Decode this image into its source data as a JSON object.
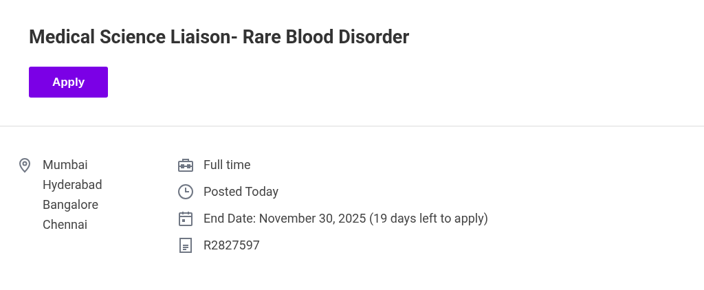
{
  "job": {
    "title": "Medical Science Liaison- Rare Blood Disorder",
    "apply_button": "Apply"
  },
  "locations": [
    "Mumbai",
    "Hyderabad",
    "Bangalore",
    "Chennai"
  ],
  "details": [
    {
      "kind": "job-type",
      "text": "Full time"
    },
    {
      "kind": "posted",
      "text": "Posted Today"
    },
    {
      "kind": "end-date",
      "text": "End Date: November 30, 2025 (19 days left to apply)"
    },
    {
      "kind": "requisition",
      "text": "R2827597"
    }
  ]
}
